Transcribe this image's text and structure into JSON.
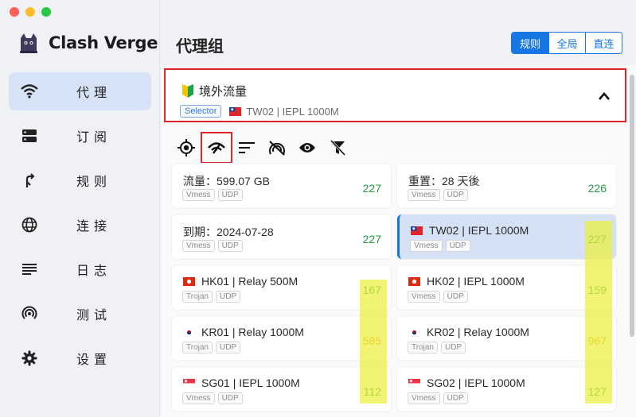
{
  "window": {
    "title": "Clash Verge"
  },
  "sidebar": {
    "brand": "Clash Verge",
    "items": [
      {
        "label": "代理",
        "icon": "wifi-icon",
        "active": true
      },
      {
        "label": "订阅",
        "icon": "server-icon",
        "active": false
      },
      {
        "label": "规则",
        "icon": "route-icon",
        "active": false
      },
      {
        "label": "连接",
        "icon": "globe-icon",
        "active": false
      },
      {
        "label": "日志",
        "icon": "list-icon",
        "active": false
      },
      {
        "label": "测试",
        "icon": "radar-icon",
        "active": false
      },
      {
        "label": "设置",
        "icon": "gear-icon",
        "active": false
      }
    ]
  },
  "header": {
    "title": "代理组",
    "modes": [
      "规则",
      "全局",
      "直连"
    ],
    "active_mode": "规则"
  },
  "group": {
    "name": "境外流量",
    "type_tag": "Selector",
    "current": "TW02 | IEPL 1000M"
  },
  "toolbar": [
    "locate-icon",
    "delay-test-icon",
    "sort-icon",
    "filter-off-icon",
    "eye-icon",
    "clear-filter-icon"
  ],
  "proxies": [
    {
      "name": "流量：599.07 GB",
      "flag": "",
      "tags": [
        "Vmess",
        "UDP"
      ],
      "delay": "227"
    },
    {
      "name": "重置：28 天後",
      "flag": "",
      "tags": [
        "Vmess",
        "UDP"
      ],
      "delay": "226"
    },
    {
      "name": "到期：2024-07-28",
      "flag": "",
      "tags": [
        "Vmess",
        "UDP"
      ],
      "delay": "227"
    },
    {
      "name": "TW02 | IEPL 1000M",
      "flag": "tw",
      "tags": [
        "Vmess",
        "UDP"
      ],
      "delay": "227",
      "selected": true
    },
    {
      "name": "HK01 | Relay 500M",
      "flag": "hk",
      "tags": [
        "Trojan",
        "UDP"
      ],
      "delay": "167"
    },
    {
      "name": "HK02 | IEPL 1000M",
      "flag": "hk",
      "tags": [
        "Vmess",
        "UDP"
      ],
      "delay": "159"
    },
    {
      "name": "KR01 | Relay 1000M",
      "flag": "kr",
      "tags": [
        "Trojan",
        "UDP"
      ],
      "delay": "585"
    },
    {
      "name": "KR02 | Relay 1000M",
      "flag": "kr",
      "tags": [
        "Trojan",
        "UDP"
      ],
      "delay": "967"
    },
    {
      "name": "SG01 | IEPL 1000M",
      "flag": "sg",
      "tags": [
        "Vmess",
        "UDP"
      ],
      "delay": "112"
    },
    {
      "name": "SG02 | IEPL 1000M",
      "flag": "sg",
      "tags": [
        "Vmess",
        "UDP"
      ],
      "delay": "127"
    }
  ],
  "colors": {
    "accent": "#1677e4",
    "delay_good": "#1f9b3e",
    "delay_slow": "#e6891a",
    "highlight_box": "#e0242b"
  }
}
